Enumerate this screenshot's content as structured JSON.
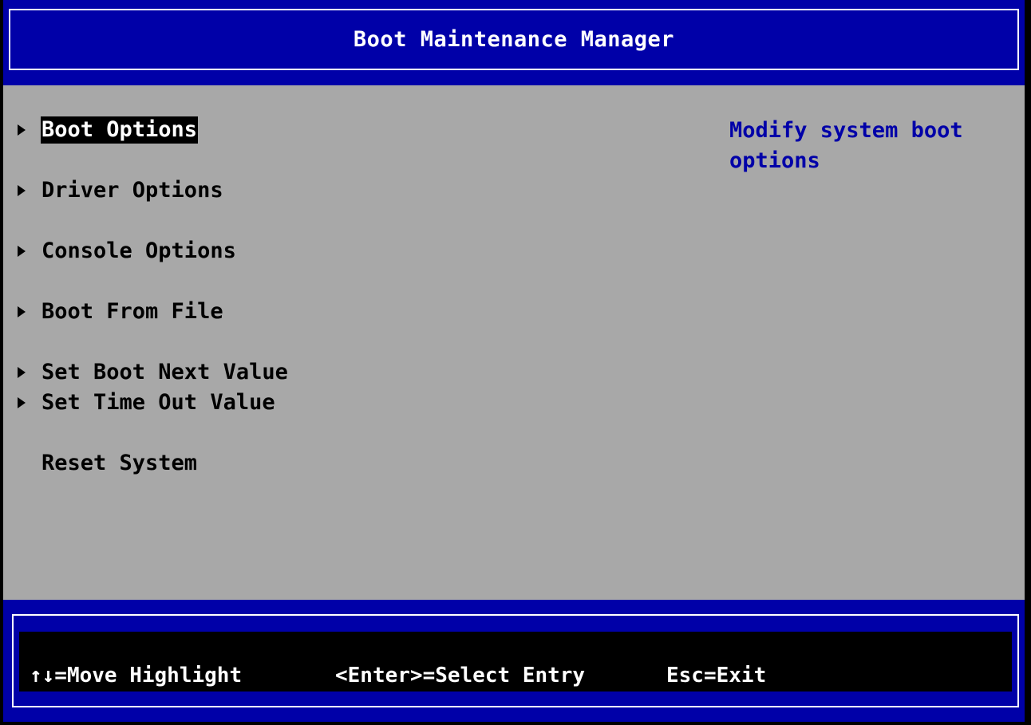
{
  "header": {
    "title": "Boot Maintenance Manager"
  },
  "menu": {
    "items": [
      {
        "label": "Boot Options",
        "has_submenu": true,
        "selected": true
      },
      {
        "label": "Driver Options",
        "has_submenu": true,
        "selected": false
      },
      {
        "label": "Console Options",
        "has_submenu": true,
        "selected": false
      },
      {
        "label": "Boot From File",
        "has_submenu": true,
        "selected": false
      },
      {
        "label": "Set Boot Next Value",
        "has_submenu": true,
        "selected": false
      },
      {
        "label": "Set Time Out Value",
        "has_submenu": true,
        "selected": false
      },
      {
        "label": "Reset System",
        "has_submenu": false,
        "selected": false
      }
    ]
  },
  "help": {
    "text": "Modify system boot options"
  },
  "footer": {
    "move_hint": "↑↓=Move Highlight",
    "select_hint": "<Enter>=Select Entry",
    "exit_hint": "Esc=Exit"
  },
  "colors": {
    "frame_blue": "#0000a8",
    "content_gray": "#a8a8a8",
    "help_blue": "#0000a8",
    "highlight_bg": "#000000",
    "highlight_fg": "#ffffff"
  },
  "icons": {
    "submenu": "triangle-right-icon"
  }
}
